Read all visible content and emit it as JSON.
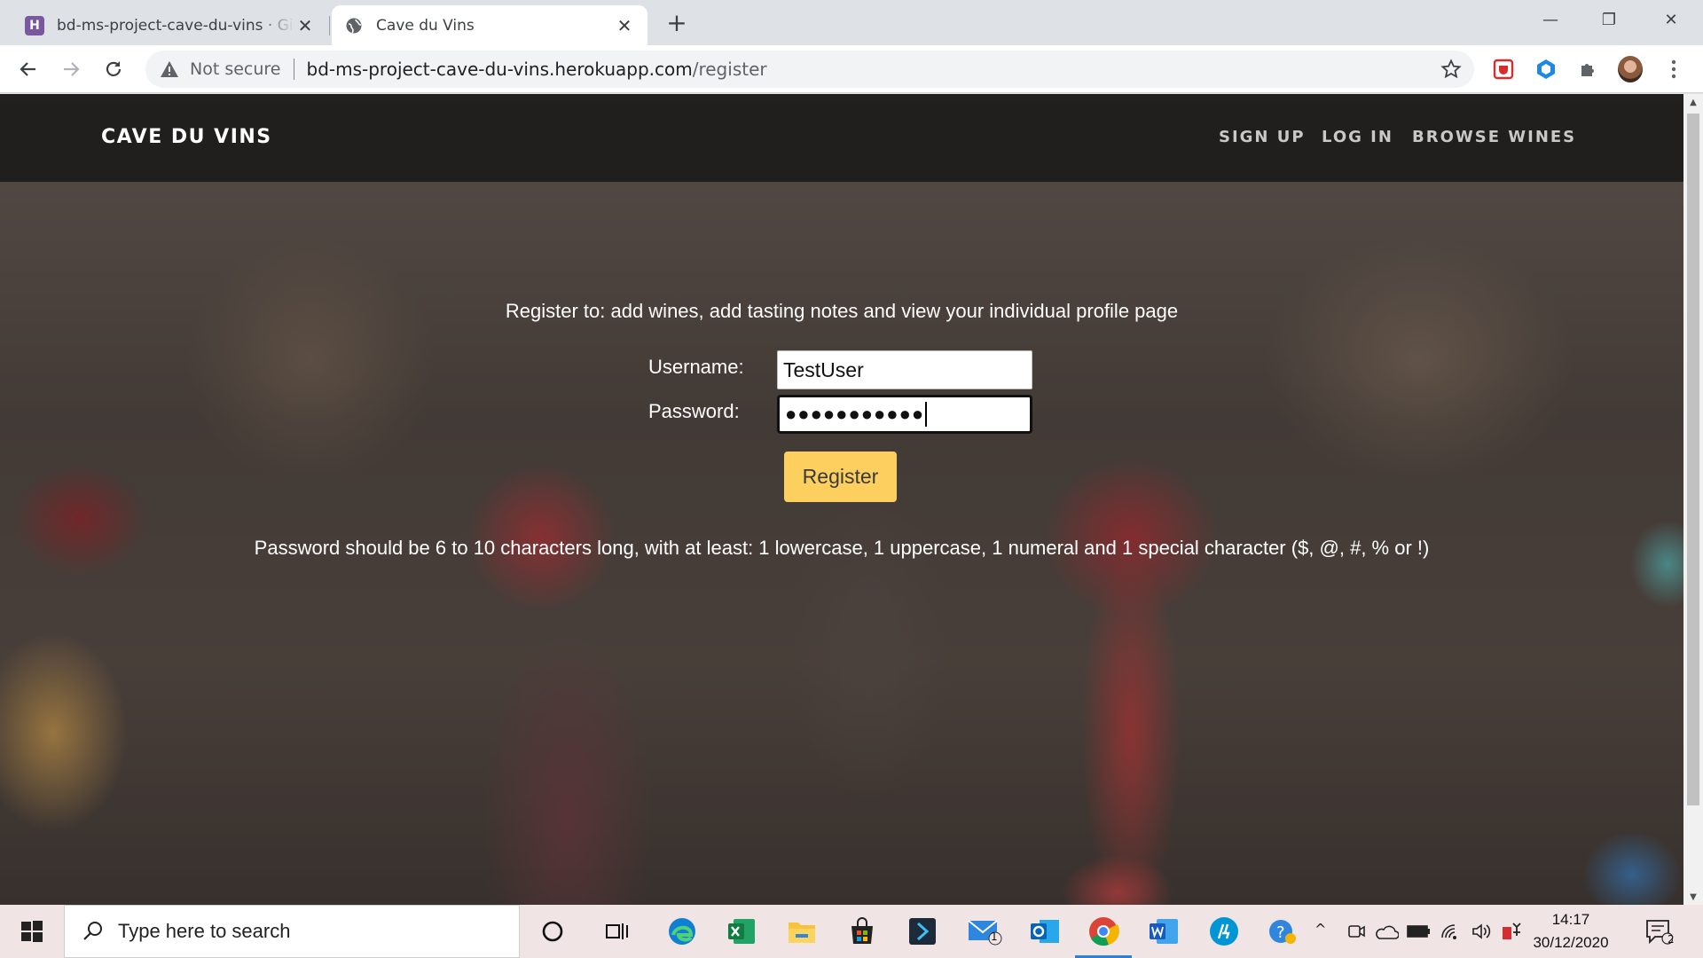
{
  "browser": {
    "tabs": [
      {
        "title": "bd-ms-project-cave-du-vins · GitHub",
        "favicon": "heroku-icon",
        "active": false
      },
      {
        "title": "Cave du Vins",
        "favicon": "globe-icon",
        "active": true
      }
    ],
    "address": {
      "security_label": "Not secure",
      "host": "bd-ms-project-cave-du-vins.herokuapp.com",
      "path": "/register"
    }
  },
  "page": {
    "brand": "CAVE DU VINS",
    "nav": {
      "signup": "SIGN UP",
      "login": "LOG IN",
      "browse": "BROWSE WINES"
    },
    "intro": "Register to: add wines, add tasting notes and view your individual profile page",
    "form": {
      "username_label": "Username:",
      "username_value": "TestUser",
      "password_label": "Password:",
      "password_mask": "●●●●●●●●●●●",
      "submit_label": "Register"
    },
    "password_hint": "Password should be 6 to 10 characters long, with at least: 1 lowercase, 1 uppercase, 1 numeral and 1 special character ($, @, #, % or !)",
    "colors": {
      "button": "#fccf5e",
      "navbar": "#161616"
    }
  },
  "taskbar": {
    "search_placeholder": "Type here to search",
    "mail_badge": "1",
    "notification_badge": "2",
    "time": "14:17",
    "date": "30/12/2020"
  }
}
